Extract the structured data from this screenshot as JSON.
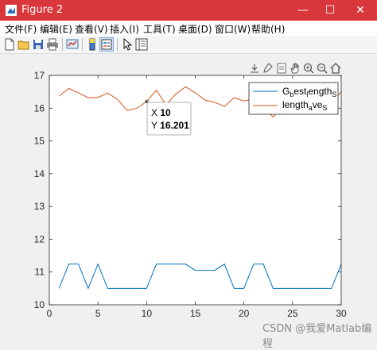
{
  "window": {
    "title": "Figure 2",
    "minimize": "—",
    "maximize": "☐",
    "close": "✕"
  },
  "menu": [
    "文件(F)",
    "编辑(E)",
    "查看(V)",
    "插入(I)",
    "工具(T)",
    "桌面(D)",
    "窗口(W)",
    "帮助(H)"
  ],
  "toolbar": [
    "new-figure-icon",
    "open-file-icon",
    "save-icon",
    "print-icon",
    "link-plot-icon",
    "colorbar-icon",
    "legend-icon",
    "edit-plot-arrow-icon",
    "property-inspector-icon"
  ],
  "axes_toolbar": [
    "export-icon",
    "brush-icon",
    "data-tips-icon",
    "pan-hand-icon",
    "zoom-in-icon",
    "zoom-out-icon",
    "home-icon"
  ],
  "chart_data": {
    "type": "line",
    "xlim": [
      0,
      30
    ],
    "ylim": [
      10,
      17
    ],
    "xticks": [
      0,
      5,
      10,
      15,
      20,
      25,
      30
    ],
    "yticks": [
      10,
      11,
      12,
      13,
      14,
      15,
      16,
      17
    ],
    "x": [
      1,
      2,
      3,
      4,
      5,
      6,
      7,
      8,
      9,
      10,
      11,
      12,
      13,
      14,
      15,
      16,
      17,
      18,
      19,
      20,
      21,
      22,
      23,
      24,
      25,
      26,
      27,
      28,
      29,
      30
    ],
    "series": [
      {
        "name": "G_best_length_S",
        "color": "#0072bd",
        "values": [
          10.5,
          11.24,
          11.24,
          10.5,
          11.24,
          10.5,
          10.5,
          10.5,
          10.5,
          10.5,
          11.24,
          11.24,
          11.24,
          11.24,
          11.05,
          11.05,
          11.05,
          11.24,
          10.5,
          10.5,
          11.24,
          11.24,
          10.5,
          10.5,
          10.5,
          10.5,
          10.5,
          10.5,
          10.5,
          11.24
        ]
      },
      {
        "name": "length_ave_S",
        "color": "#d95319",
        "values": [
          16.37,
          16.6,
          16.47,
          16.32,
          16.33,
          16.46,
          16.27,
          15.93,
          16.0,
          16.201,
          16.55,
          16.1,
          16.43,
          16.65,
          16.47,
          16.25,
          16.18,
          16.05,
          16.32,
          16.22,
          16.28,
          16.05,
          15.73,
          16.03,
          16.21,
          16.05,
          16.28,
          16.18,
          16.15,
          16.5
        ]
      }
    ],
    "legend": {
      "placement": "top-right",
      "entries": [
        {
          "base": "G",
          "sub1": "b",
          "mid": "est",
          "sub2": "l",
          "tail": "ength",
          "sub3": "S"
        },
        {
          "base": "length",
          "sub1": "a",
          "mid": "ve",
          "sub2": "S",
          "tail": "",
          "sub3": ""
        }
      ]
    },
    "datatip": {
      "x_label": "X",
      "x_value": "10",
      "y_label": "Y",
      "y_value": "16.201",
      "series": 1,
      "x": 10,
      "y": 16.201
    }
  },
  "watermark": "CSDN @我爱Matlab编程"
}
